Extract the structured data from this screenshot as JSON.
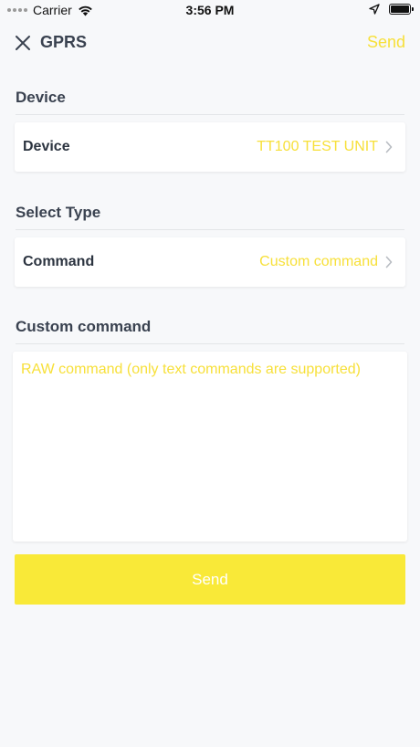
{
  "status_bar": {
    "carrier": "Carrier",
    "time": "3:56 PM"
  },
  "nav": {
    "title": "GPRS",
    "send_label": "Send"
  },
  "sections": {
    "device_header": "Device",
    "select_type_header": "Select Type",
    "custom_command_header": "Custom command"
  },
  "device_row": {
    "label": "Device",
    "value": "TT100 TEST UNIT"
  },
  "command_row": {
    "label": "Command",
    "value": "Custom command"
  },
  "custom_command": {
    "value": "",
    "placeholder": "RAW command (only text commands are supported)"
  },
  "send_button": {
    "label": "Send"
  },
  "colors": {
    "accent": "#f7e03a",
    "button_bg": "#f9e938",
    "background": "#f7f8fa",
    "text": "#2c3440"
  },
  "icons": {
    "close": "close-icon",
    "chevron": "chevron-right-icon",
    "wifi": "wifi-icon",
    "location": "location-arrow-icon",
    "battery": "battery-icon"
  }
}
